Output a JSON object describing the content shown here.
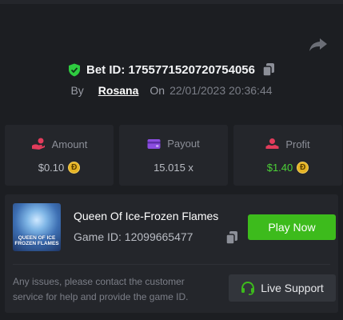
{
  "bet": {
    "label": "Bet ID: 1755771520720754056",
    "by_label": "By",
    "username": "Rosana",
    "on_label": "On",
    "datetime": "22/01/2023 20:36:44"
  },
  "stats": [
    {
      "label": "Amount",
      "value": "$0.10",
      "icon": "money-hand-icon",
      "icon_color": "#e23c5b",
      "coin": "Đ"
    },
    {
      "label": "Payout",
      "value": "15.015 x",
      "icon": "wallet-icon",
      "icon_color": "#8b4de0"
    },
    {
      "label": "Profit",
      "value": "$1.40",
      "icon": "profit-hand-icon",
      "icon_color": "#e23c5b",
      "value_color": "#4cd137",
      "coin": "Đ"
    }
  ],
  "game": {
    "thumb_text": "QUEEN OF ICE FROZEN FLAMES",
    "title": "Queen Of Ice-Frozen Flames",
    "id_label": "Game ID: 12099665477",
    "play_label": "Play Now"
  },
  "support": {
    "notice": "Any issues, please contact the customer service for help and provide the game ID.",
    "button_label": "Live Support"
  },
  "colors": {
    "accent_green": "#3dbb1c",
    "profit_green": "#4cd137",
    "coin_gold": "#e5b324"
  }
}
